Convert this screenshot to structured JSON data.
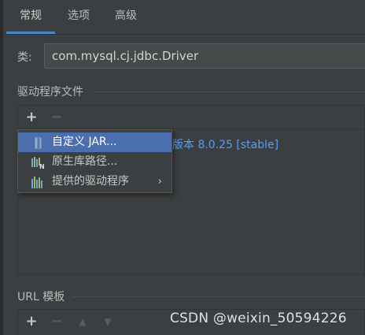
{
  "tabs": [
    {
      "label": "常规",
      "active": true
    },
    {
      "label": "选项",
      "active": false
    },
    {
      "label": "高级",
      "active": false
    }
  ],
  "class_field": {
    "label": "类:",
    "value": "com.mysql.cj.jdbc.Driver"
  },
  "driver_files": {
    "title": "驱动程序文件",
    "add_icon": "plus-icon",
    "remove_icon": "minus-icon",
    "version_text": "版本 8.0.25 [stable]"
  },
  "popup_menu": {
    "items": [
      {
        "label": "自定义 JAR...",
        "icon": "jar-icon",
        "selected": true
      },
      {
        "label": "原生库路径...",
        "icon": "native-library-icon",
        "selected": false
      },
      {
        "label": "提供的驱动程序",
        "icon": "provided-driver-icon",
        "selected": false,
        "submenu_glyph": "›"
      }
    ]
  },
  "url_templates": {
    "title": "URL 模板",
    "toolbar_icons": [
      "plus-icon",
      "minus-icon",
      "arrow-up-icon",
      "arrow-down-icon"
    ]
  },
  "glyphs": {
    "plus": "+",
    "minus": "−",
    "up": "▲",
    "down": "▼"
  },
  "watermark": "CSDN @weixin_50594226",
  "colors": {
    "background": "#3c3f41",
    "accent": "#4a88c7",
    "selection": "#4b6eaf",
    "link": "#589df6"
  }
}
